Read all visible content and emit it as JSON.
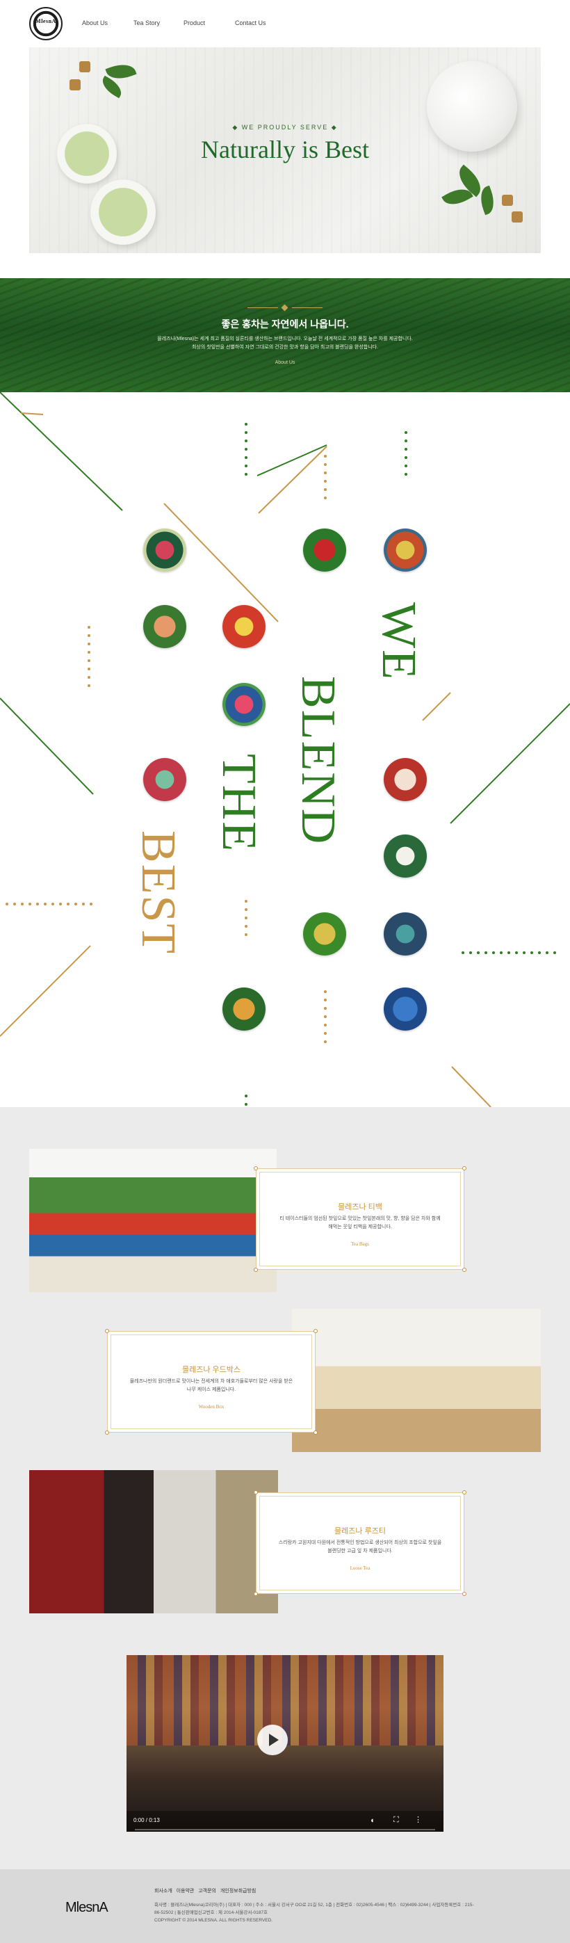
{
  "header": {
    "logo_text": "MlesnA",
    "nav": [
      "About Us",
      "Tea Story",
      "Product",
      "Contact Us"
    ]
  },
  "hero": {
    "tagline": "WE PROUDLY SERVE",
    "title": "Naturally is Best"
  },
  "banner": {
    "title": "좋은 홍차는 자연에서 나옵니다.",
    "desc_lines": [
      "믈레즈나(Mlesna)는 세계 최고 품질의 실론티를 생산하는 브랜드입니다. 오늘날 전 세계적으로 가장 품질 높은 차를 제공합니다.",
      "최상의 찻잎만을 선별하여 자연 그대로의 건강한 맛과 향을 담아 최고의 블렌딩을 완성합니다."
    ],
    "link": "About Us"
  },
  "blend": {
    "words": [
      "WE",
      "BLEND",
      "THE",
      "BEST"
    ],
    "colors": {
      "green": "#2f7d22",
      "gold": "#c9974a"
    }
  },
  "products": [
    {
      "title": "믈레즈나 티백",
      "desc": "티 테이스터들의 엄선된 찻잎으로 맛있는 찻잎본래의 맛, 향, 향을 담은 차와 함께 해먹는 웃잎 티백을 제공합니다.",
      "sub": "Tea Bags"
    },
    {
      "title": "믈레즈나 우드박스",
      "desc": "믈레즈나만의 원더랜드로 맛이나는 전세계의 차 애호가들로부터 많은 사랑을 받은 나무 케이스 제품입니다.",
      "sub": "Wooden Box"
    },
    {
      "title": "믈레즈나 루즈티",
      "desc": "스리랑카 고원지대 다원에서 전통적인 방법으로 생산되어 최상의 조합으로 찻잎을 블렌딩한 고급 잎 차 제품입니다.",
      "sub": "Loose Tea"
    }
  ],
  "video": {
    "time": "0:00 / 0:13"
  },
  "footer": {
    "logo": "MlesnA",
    "links": [
      "회사소개",
      "이용약관",
      "고객문의",
      "개인정보취급방침"
    ],
    "info_lines": [
      "회사명 : 믈레즈나(Mlesna)코리아(주) | 대표자 : 000 | 주소 : 서울시 강서구 OO로 21길 52, 1층 | 전화번호 : 02)2605-4546 | 팩스 : 02)6499-3244 | 사업자등록번호 : 215-",
      "86-52502 | 통신판매업신고번호 : 제 2014-서울강서-0187호",
      "COPYRIGHT © 2014 MLESNA. ALL RIGHTS RESERVED."
    ]
  }
}
